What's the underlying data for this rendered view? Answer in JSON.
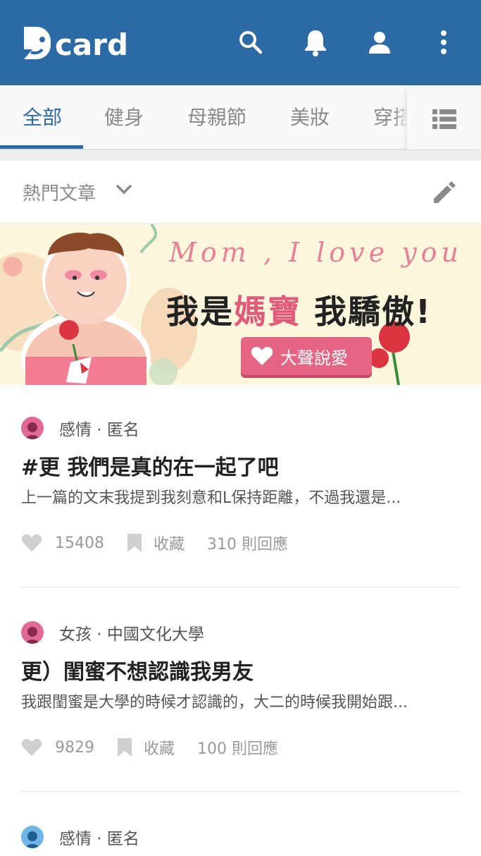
{
  "header": {
    "logo_text": "card",
    "icons": [
      "search-icon",
      "bell-icon",
      "user-icon",
      "more-vertical-icon"
    ],
    "brand_color": "#2c6aa6"
  },
  "tabs": {
    "items": [
      {
        "label": "全部",
        "active": true
      },
      {
        "label": "健身"
      },
      {
        "label": "母親節"
      },
      {
        "label": "美妝"
      },
      {
        "label": "穿搭"
      }
    ],
    "menu_icon": "list-icon"
  },
  "section": {
    "title": "熱門文章",
    "chevron_icon": "chevron-down-icon",
    "edit_icon": "pencil-icon"
  },
  "banner": {
    "mom_text": "Mom , I love you",
    "headline_part1": "我是",
    "headline_pink": "媽寶",
    "headline_part2": " 我驕傲!",
    "button_label": "大聲說愛"
  },
  "posts": [
    {
      "board": "感情 · 匿名",
      "avatar_color": "#e06a94",
      "title": "#更 我們是真的在一起了吧",
      "excerpt": "上一篇的文末我提到我刻意和L保持距離，不過我還是...",
      "likes": "15408",
      "save_label": "收藏",
      "comments": "310 則回應"
    },
    {
      "board": "女孩 · 中國文化大學",
      "avatar_color": "#e06a94",
      "title": "更）閨蜜不想認識我男友",
      "excerpt": "我跟閨蜜是大學的時候才認識的，大二的時候我開始跟...",
      "likes": "9829",
      "save_label": "收藏",
      "comments": "100 則回應"
    },
    {
      "board": "感情 · 匿名",
      "avatar_color": "#6fb5e6"
    }
  ]
}
